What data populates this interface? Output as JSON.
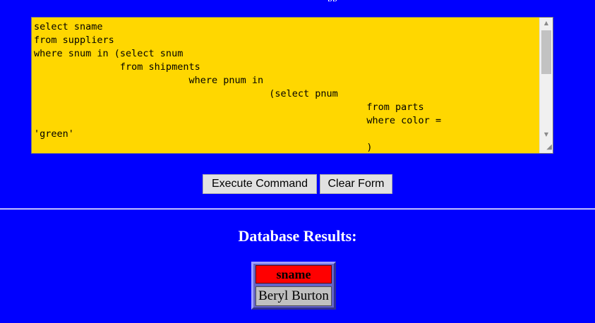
{
  "header": {
    "top_fragment": "pp"
  },
  "query_editor": {
    "value": "select sname\nfrom suppliers\nwhere snum in (select snum\n               from shipments\n                           where pnum in\n                                         (select pnum\n                                                          from parts\n                                                          where color =\n'green'\n                                                          )",
    "background": "#ffd700"
  },
  "buttons": {
    "execute_label": "Execute Command",
    "clear_label": "Clear Form"
  },
  "results": {
    "heading": "Database Results:",
    "columns": [
      "sname"
    ],
    "rows": [
      [
        "Beryl Burton"
      ]
    ]
  },
  "colors": {
    "page_background": "#0000ff",
    "header_cell": "#ff0000",
    "data_cell": "#c0c0c0",
    "heading_text": "#ffffff"
  }
}
